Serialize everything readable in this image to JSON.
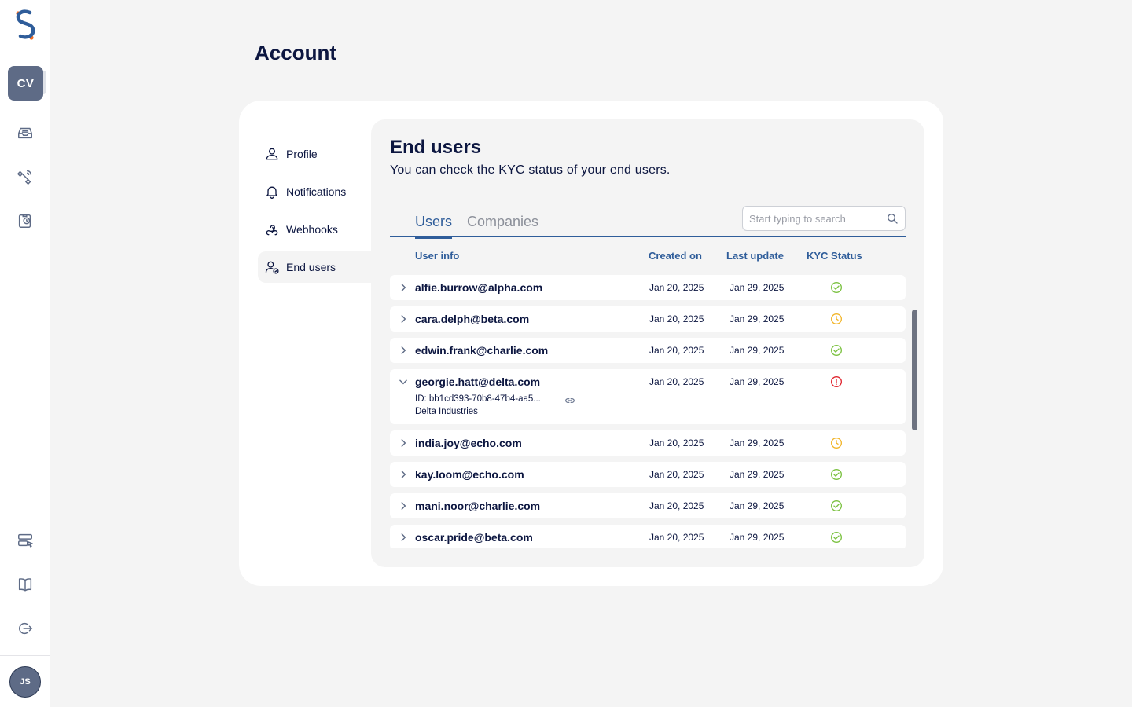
{
  "app": {
    "workspace_initials": "CV",
    "user_initials": "JS"
  },
  "page": {
    "title": "Account"
  },
  "subnav": {
    "items": [
      {
        "label": "Profile",
        "icon": "user-icon"
      },
      {
        "label": "Notifications",
        "icon": "bell-icon"
      },
      {
        "label": "Webhooks",
        "icon": "webhook-icon"
      },
      {
        "label": "End users",
        "icon": "user-check-icon",
        "active": true
      }
    ]
  },
  "panel": {
    "title": "End users",
    "subtitle": "You can check the KYC status of your end users."
  },
  "tabs": [
    {
      "label": "Users",
      "active": true
    },
    {
      "label": "Companies",
      "active": false
    }
  ],
  "search": {
    "placeholder": "Start typing to search"
  },
  "table": {
    "headers": {
      "user_info": "User info",
      "created": "Created on",
      "updated": "Last update",
      "kyc": "KYC Status"
    },
    "rows": [
      {
        "email": "alfie.burrow@alpha.com",
        "created": "Jan 20, 2025",
        "updated": "Jan 29, 2025",
        "kyc": "verified"
      },
      {
        "email": "cara.delph@beta.com",
        "created": "Jan 20, 2025",
        "updated": "Jan 29, 2025",
        "kyc": "pending"
      },
      {
        "email": "edwin.frank@charlie.com",
        "created": "Jan 20, 2025",
        "updated": "Jan 29, 2025",
        "kyc": "verified"
      },
      {
        "email": "georgie.hatt@delta.com",
        "created": "Jan 20, 2025",
        "updated": "Jan 29, 2025",
        "kyc": "rejected",
        "expanded": true,
        "id": "ID: bb1cd393-70b8-47b4-aa5...",
        "company": "Delta Industries"
      },
      {
        "email": "india.joy@echo.com",
        "created": "Jan 20, 2025",
        "updated": "Jan 29, 2025",
        "kyc": "pending"
      },
      {
        "email": "kay.loom@echo.com",
        "created": "Jan 20, 2025",
        "updated": "Jan 29, 2025",
        "kyc": "verified"
      },
      {
        "email": "mani.noor@charlie.com",
        "created": "Jan 20, 2025",
        "updated": "Jan 29, 2025",
        "kyc": "verified"
      },
      {
        "email": "oscar.pride@beta.com",
        "created": "Jan 20, 2025",
        "updated": "Jan 29, 2025",
        "kyc": "verified"
      }
    ]
  },
  "colors": {
    "accent": "#2f5d9a",
    "navy": "#0c1640",
    "status_verified": "#7cc242",
    "status_pending": "#f2b52a",
    "status_rejected": "#e0262f",
    "logo_orange": "#f26b21",
    "logo_blue": "#2f5d9a"
  }
}
